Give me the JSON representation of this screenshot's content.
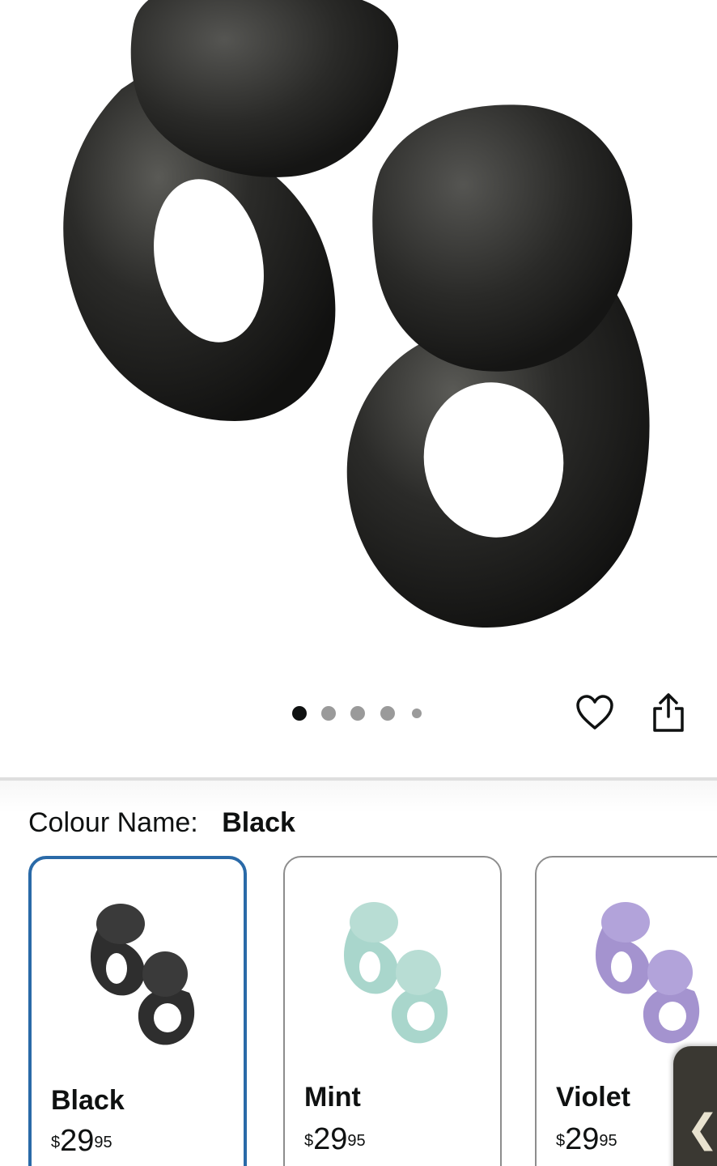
{
  "product": {
    "image_alt": "Black loop earplugs",
    "carousel": {
      "total": 5,
      "active_index": 0
    }
  },
  "actions": {
    "wishlist_icon": "heart-icon",
    "share_icon": "share-icon"
  },
  "colour": {
    "label": "Colour Name:",
    "selected": "Black"
  },
  "variants": [
    {
      "name": "Black",
      "price_currency": "$",
      "price_whole": "29",
      "price_fraction": "95",
      "color": "#2e2e2e",
      "selected": true
    },
    {
      "name": "Mint",
      "price_currency": "$",
      "price_whole": "29",
      "price_fraction": "95",
      "color": "#a9d6cc",
      "selected": false
    },
    {
      "name": "Violet",
      "price_currency": "$",
      "price_whole": "29",
      "price_fraction": "95",
      "color": "#a493cf",
      "selected": false
    }
  ],
  "side_tab": {
    "icon": "chevron-left-icon",
    "glyph": "❮"
  },
  "colors": {
    "selected_border": "#2a6aa8",
    "divider": "#dedede",
    "dot_active": "#0f1111",
    "dot_inactive": "#9a9a9a"
  }
}
